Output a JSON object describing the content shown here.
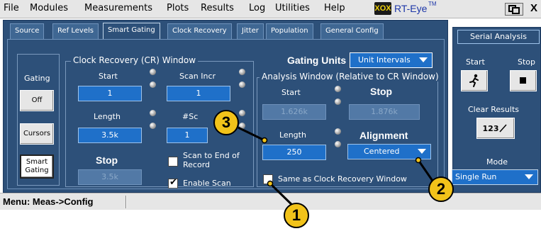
{
  "menu": [
    "File",
    "Modules",
    "Measurements",
    "Plots",
    "Results",
    "Log",
    "Utilities",
    "Help"
  ],
  "logo": {
    "badge": "XOX",
    "name": "RT-Eye",
    "tm": "TM"
  },
  "window": {
    "close_label": "X"
  },
  "tabs": [
    "Source",
    "Ref Levels",
    "Smart Gating",
    "Clock Recovery",
    "Jitter",
    "Population",
    "General Config"
  ],
  "active_tab": "Smart Gating",
  "gating": {
    "label": "Gating",
    "buttons": [
      "Off",
      "Cursors",
      "Smart Gating"
    ],
    "selected": "Smart Gating"
  },
  "cr_window": {
    "title": "Clock Recovery (CR) Window",
    "start_label": "Start",
    "start_value": "1",
    "scan_incr_label": "Scan Incr",
    "scan_incr_value": "1",
    "length_label": "Length",
    "length_value": "3.5k",
    "num_scans_label": "#Sc",
    "num_scans_value": "1",
    "stop_label": "Stop",
    "stop_value": "3.5k",
    "scan_to_end_label": "Scan to End of Record",
    "enable_scan_label": "Enable Scan"
  },
  "gating_units": {
    "label": "Gating Units",
    "value": "Unit Intervals"
  },
  "analysis_window": {
    "title": "Analysis Window (Relative to CR Window)",
    "start_label": "Start",
    "start_value": "1.626k",
    "stop_label": "Stop",
    "stop_value": "1.876k",
    "length_label": "Length",
    "length_value": "250",
    "alignment_label": "Alignment",
    "alignment_value": "Centered",
    "same_as_cr_label": "Same as Clock Recovery Window"
  },
  "serial_analysis": {
    "title": "Serial Analysis",
    "start_label": "Start",
    "stop_label": "Stop",
    "clear_results_label": "Clear Results",
    "clear_icon_text": "123",
    "mode_label": "Mode",
    "mode_value": "Single Run"
  },
  "status": {
    "text": "Menu: Meas->Config"
  },
  "callouts": [
    "1",
    "2",
    "3"
  ],
  "colors": {
    "panel": "#2d5079",
    "field": "#1f70c9",
    "callout": "#f2c31a"
  }
}
